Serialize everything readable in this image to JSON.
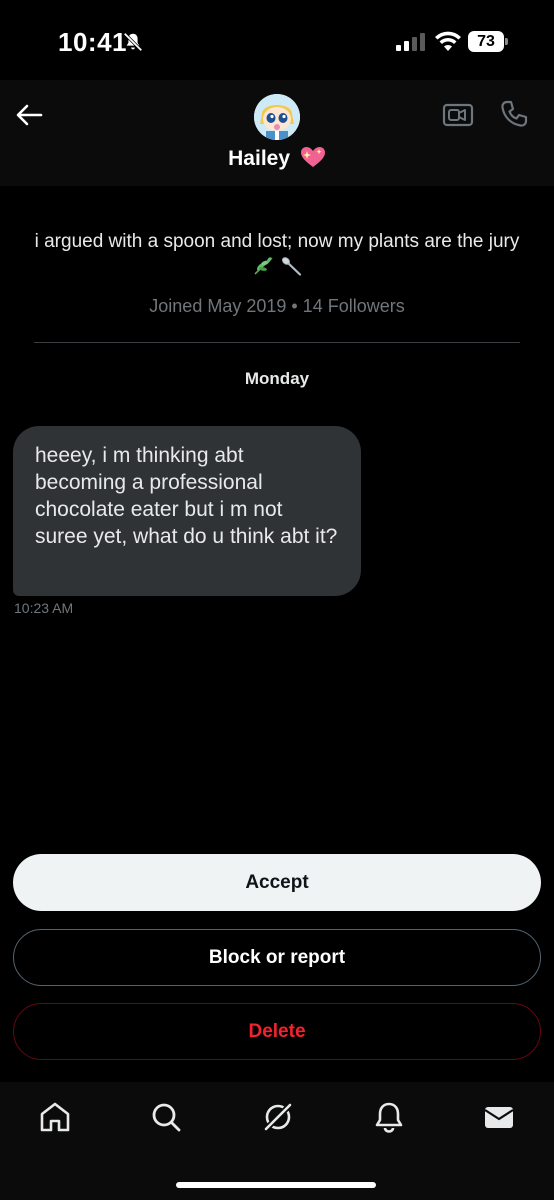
{
  "status_bar": {
    "time": "10:41",
    "battery": "73",
    "icons": [
      "bell-slash-icon",
      "signal-icon",
      "wifi-icon",
      "battery-icon"
    ]
  },
  "header": {
    "name": "Hailey",
    "name_emoji": "sparkling-heart",
    "icons": [
      "back-arrow-icon",
      "video-call-icon",
      "phone-icon"
    ]
  },
  "profile": {
    "bio": "i argued with a spoon and lost; now my plants are the jury",
    "bio_emojis": [
      "herb",
      "spoon"
    ],
    "joined": "Joined May 2019 • 14 Followers"
  },
  "conversation": {
    "day_label": "Monday",
    "messages": [
      {
        "text": "heeey, i m thinking abt becoming a professional chocolate eater but i m not suree yet, what do u think abt it?",
        "time": "10:23 AM"
      }
    ]
  },
  "actions": {
    "accept": "Accept",
    "block_report": "Block or report",
    "delete": "Delete"
  },
  "bottom_nav": {
    "items": [
      "home-icon",
      "search-icon",
      "grok-icon",
      "notifications-icon",
      "messages-icon"
    ]
  },
  "colors": {
    "background": "#000000",
    "bubble": "#2f3336",
    "muted_text": "#71767b",
    "accept_bg": "#eff3f4",
    "delete_red": "#f4212e"
  }
}
